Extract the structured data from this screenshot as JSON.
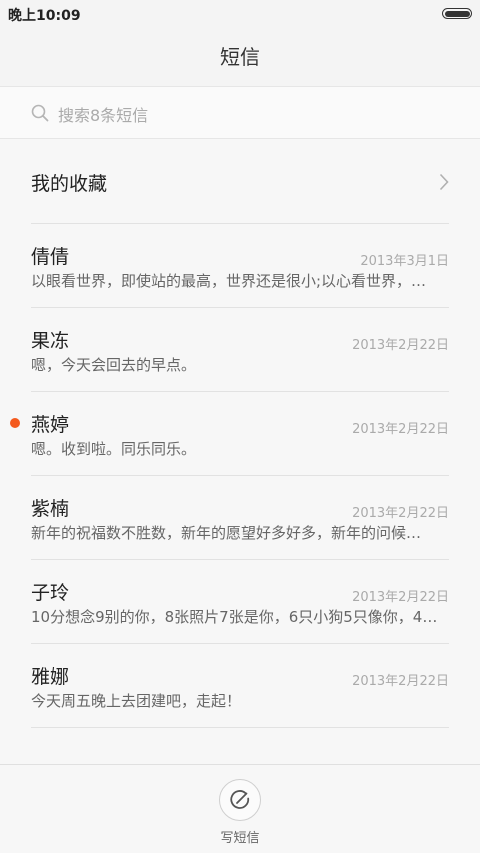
{
  "status_bar": {
    "time": "晚上10:09"
  },
  "header": {
    "title": "短信"
  },
  "search": {
    "placeholder": "搜索8条短信"
  },
  "favorites": {
    "label": "我的收藏"
  },
  "messages": [
    {
      "name": "倩倩",
      "date": "2013年3月1日",
      "preview": "以眼看世界，即使站的最高，世界还是很小;以心看世界，…",
      "unread": false
    },
    {
      "name": "果冻",
      "date": "2013年2月22日",
      "preview": "嗯，今天会回去的早点。",
      "unread": false
    },
    {
      "name": "燕婷",
      "date": "2013年2月22日",
      "preview": "嗯。收到啦。同乐同乐。",
      "unread": true
    },
    {
      "name": "紫楠",
      "date": "2013年2月22日",
      "preview": "新年的祝福数不胜数，新年的愿望好多好多，新年的问候…",
      "unread": false
    },
    {
      "name": "子玲",
      "date": "2013年2月22日",
      "preview": "10分想念9别的你，8张照片7张是你，6只小狗5只像你，4…",
      "unread": false
    },
    {
      "name": "雅娜",
      "date": "2013年2月22日",
      "preview": "今天周五晚上去团建吧，走起！",
      "unread": false
    }
  ],
  "compose": {
    "label": "写短信"
  },
  "colors": {
    "unread_dot": "#f45a1e",
    "background": "#f7f7f7"
  }
}
